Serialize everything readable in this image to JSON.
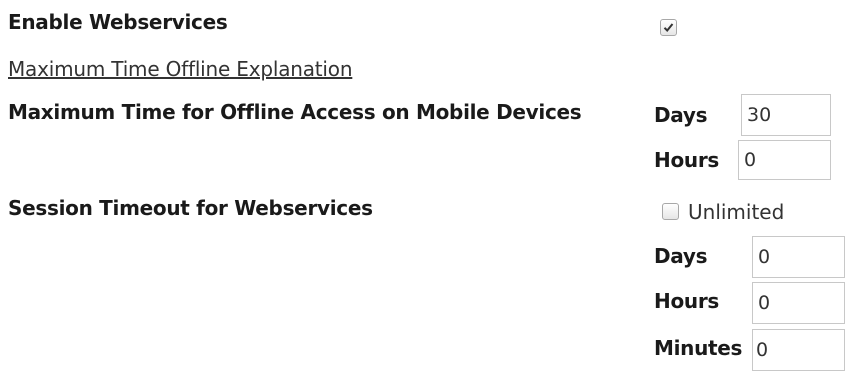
{
  "webservices": {
    "enable_label": "Enable Webservices",
    "enabled": true
  },
  "offline": {
    "explanation_link": "Maximum Time Offline Explanation",
    "label": "Maximum Time for Offline Access on Mobile Devices",
    "days_label": "Days",
    "days_value": "30",
    "hours_label": "Hours",
    "hours_value": "0"
  },
  "session": {
    "label": "Session Timeout for Webservices",
    "unlimited_label": "Unlimited",
    "unlimited_checked": false,
    "days_label": "Days",
    "days_value": "0",
    "hours_label": "Hours",
    "hours_value": "0",
    "minutes_label": "Minutes",
    "minutes_value": "0"
  }
}
